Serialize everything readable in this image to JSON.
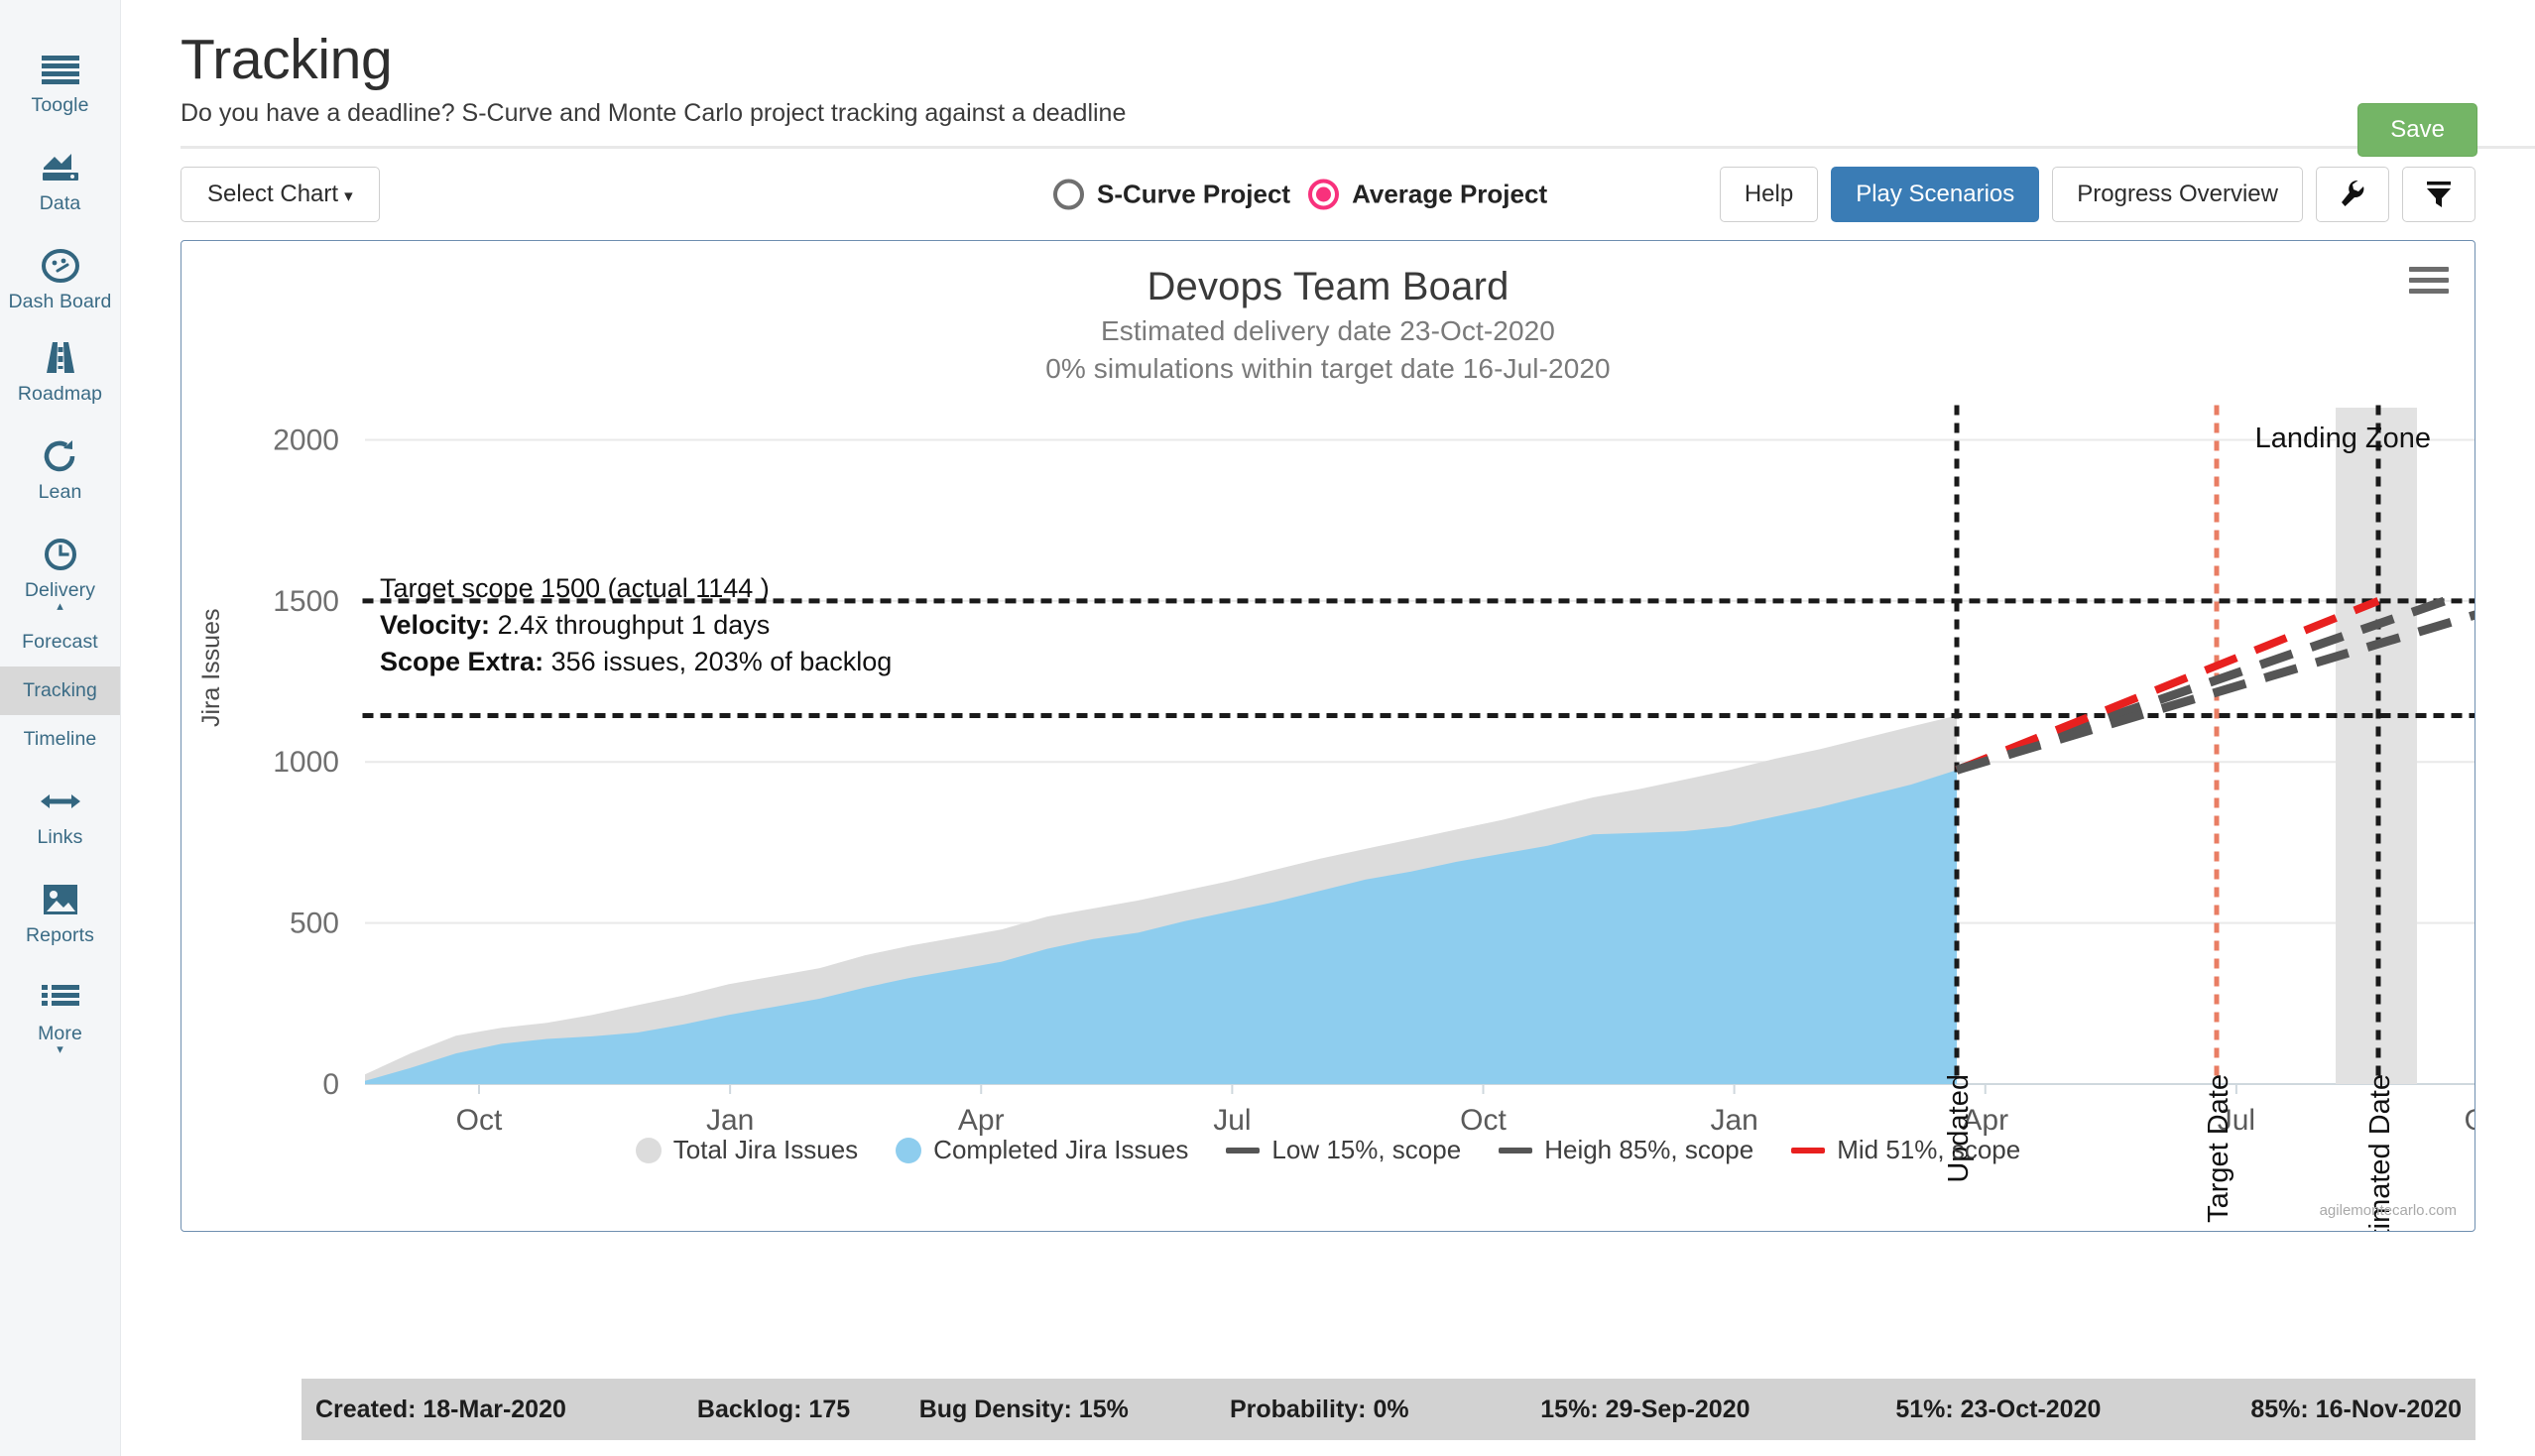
{
  "sidebar": {
    "items": [
      {
        "label": "Toogle",
        "icon": "hamburger-icon",
        "icon_only": false,
        "active": false
      },
      {
        "label": "Data",
        "icon": "data-chart-icon",
        "icon_only": false,
        "active": false
      },
      {
        "label": "Dash Board",
        "icon": "gauge-icon",
        "icon_only": false,
        "active": false
      },
      {
        "label": "Roadmap",
        "icon": "road-icon",
        "icon_only": false,
        "active": false
      },
      {
        "label": "Lean",
        "icon": "refresh-icon",
        "icon_only": false,
        "active": false
      },
      {
        "label": "Delivery",
        "icon": "clock-icon",
        "icon_only": false,
        "active": false,
        "caret": "chevron-up"
      },
      {
        "label": "Forecast",
        "icon": null,
        "icon_only": true,
        "active": false
      },
      {
        "label": "Tracking",
        "icon": null,
        "icon_only": true,
        "active": true
      },
      {
        "label": "Timeline",
        "icon": null,
        "icon_only": true,
        "active": false
      },
      {
        "label": "Links",
        "icon": "arrows-horizontal-icon",
        "icon_only": false,
        "active": false
      },
      {
        "label": "Reports",
        "icon": "image-icon",
        "icon_only": false,
        "active": false
      },
      {
        "label": "More",
        "icon": "list-icon",
        "icon_only": false,
        "active": false,
        "caret": "chevron-down"
      }
    ]
  },
  "header": {
    "title": "Tracking",
    "subtitle": "Do you have a deadline? S-Curve and Monte Carlo project tracking against a deadline",
    "save_label": "Save",
    "save_color": "#74b566"
  },
  "toolbar": {
    "select_chart_label": "Select Chart",
    "select_chart_caret": "▾",
    "radios": [
      {
        "label": "S-Curve Project",
        "checked": false
      },
      {
        "label": "Average Project",
        "checked": true
      }
    ],
    "radio_accent": "#f8317c",
    "help_label": "Help",
    "play_scenarios_label": "Play Scenarios",
    "play_scenarios_color": "#3a7cb5",
    "progress_overview_label": "Progress Overview",
    "wrench_icon": "wrench-icon",
    "filter_icon": "filter-icon"
  },
  "chart_data": {
    "type": "area",
    "title": "Devops Team Board",
    "subtitle_1": "Estimated delivery date 23-Oct-2020",
    "subtitle_2": "0% simulations within target date 16-Jul-2020",
    "xlabel": "",
    "ylabel": "Jira Issues",
    "ylim": [
      0,
      2100
    ],
    "yticks": [
      0,
      500,
      1000,
      1500,
      2000
    ],
    "xticks": [
      "Oct",
      "Jan",
      "Apr",
      "Jul",
      "Oct",
      "Jan",
      "Apr",
      "Jul",
      "Oct"
    ],
    "grid": true,
    "legend_position": "bottom",
    "series": [
      {
        "name": "Total Jira Issues",
        "color": "#dcdcdc",
        "type": "area",
        "values": [
          30,
          95,
          150,
          175,
          190,
          215,
          245,
          275,
          310,
          335,
          360,
          400,
          430,
          455,
          480,
          520,
          545,
          570,
          600,
          630,
          665,
          700,
          730,
          760,
          790,
          820,
          855,
          890,
          915,
          945,
          975,
          1010,
          1040,
          1075,
          1110,
          1144
        ]
      },
      {
        "name": "Completed Jira Issues",
        "color": "#8ecdee",
        "type": "area",
        "values": [
          10,
          50,
          95,
          125,
          140,
          148,
          160,
          185,
          215,
          240,
          265,
          300,
          330,
          355,
          380,
          420,
          450,
          470,
          505,
          535,
          565,
          600,
          635,
          660,
          690,
          715,
          740,
          775,
          780,
          785,
          800,
          830,
          860,
          895,
          930,
          975
        ]
      },
      {
        "name": "Low 15%, scope",
        "color": "#555555",
        "type": "dashed-line",
        "start_value": 975,
        "end_value": 1500,
        "end_label": "29-Sep-2020"
      },
      {
        "name": "Heigh 85%, scope",
        "color": "#555555",
        "type": "dashed-line",
        "start_value": 975,
        "end_value": 1500,
        "end_label": "16-Nov-2020"
      },
      {
        "name": "Mid 51%, scope",
        "color": "#e8201f",
        "type": "dashed-line",
        "start_value": 975,
        "end_value": 1500,
        "end_label": "23-Oct-2020"
      }
    ],
    "annotations": {
      "target_scope": "Target scope 1500 (actual 1144 )",
      "velocity_label": "Velocity:",
      "velocity_value": "2.4x̄ throughput 1 days",
      "scope_extra_label": "Scope Extra:",
      "scope_extra_value": "356 issues, 203% of backlog",
      "landing_zone": "Landing Zone",
      "updated": "Updated",
      "target_date": "Target Date",
      "estimated_date": "Estimated Date",
      "hline_levels": [
        1500,
        1144
      ],
      "target_date_color": "#e97d63"
    },
    "credit": "agilemontecarlo.com"
  },
  "legend": [
    {
      "label": "Total Jira Issues",
      "marker": "dot",
      "color": "#dcdcdc"
    },
    {
      "label": "Completed Jira Issues",
      "marker": "dot",
      "color": "#8ecdee"
    },
    {
      "label": "Low 15%, scope",
      "marker": "line",
      "color": "#555555"
    },
    {
      "label": "Heigh 85%, scope",
      "marker": "line",
      "color": "#555555"
    },
    {
      "label": "Mid 51%, scope",
      "marker": "line",
      "color": "#e8201f"
    }
  ],
  "footer": {
    "cells": [
      "Created: 18-Mar-2020",
      "Backlog: 175",
      "Bug Density: 15%",
      "Probability: 0%",
      "15%: 29-Sep-2020",
      "51%: 23-Oct-2020",
      "85%: 16-Nov-2020"
    ]
  }
}
